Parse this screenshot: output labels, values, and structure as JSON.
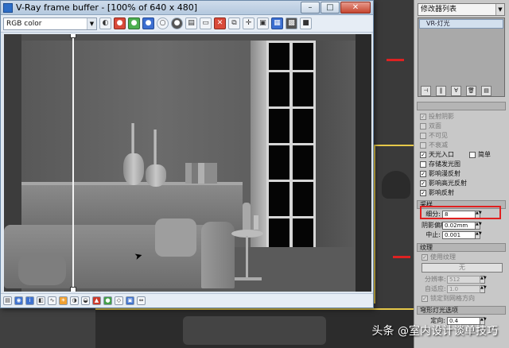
{
  "vfb": {
    "title": "V-Ray frame buffer - [100% of 640 x 480]",
    "channel_select": "RGB color",
    "window_buttons": {
      "minimize": "–",
      "maximize": "□",
      "close": "✕"
    }
  },
  "modifier_list": "修改器列表",
  "modifier_stack": {
    "items": [
      "VR-灯光"
    ]
  },
  "options": {
    "items": [
      {
        "label": "投射阴影",
        "checked": true,
        "enabled": false
      },
      {
        "label": "双面",
        "checked": false,
        "enabled": false
      },
      {
        "label": "不可见",
        "checked": false,
        "enabled": false
      },
      {
        "label": "不衰减",
        "checked": false,
        "enabled": false
      },
      {
        "label": "天光入口",
        "checked": true,
        "enabled": true
      },
      {
        "label": "简单",
        "checked": false,
        "enabled": true
      },
      {
        "label": "存储发光图",
        "checked": false,
        "enabled": true
      },
      {
        "label": "影响漫反射",
        "checked": true,
        "enabled": true
      },
      {
        "label": "影响高光反射",
        "checked": true,
        "enabled": true
      },
      {
        "label": "影响反射",
        "checked": true,
        "enabled": true
      }
    ]
  },
  "sampling": {
    "header": "采样",
    "subdivs_label": "细分:",
    "subdivs_value": "8",
    "shadow_bias_label": "阴影偏移:",
    "shadow_bias_value": "0.02mm",
    "cutoff_label": "中止:",
    "cutoff_value": "0.001"
  },
  "texture": {
    "header": "纹理",
    "use_texture_label": "使用纹理",
    "none_button": "无",
    "resolution_label": "分辨率:",
    "resolution_value": "512",
    "adaptive_label": "自适应:",
    "adaptive_value": "1.0",
    "lock_label": "锁定到网格方向"
  },
  "dome": {
    "header": "穹形灯光选项",
    "target_label": "定向:",
    "target_value": "0.4"
  },
  "watermark": "头条 @室内设计谈单技巧"
}
